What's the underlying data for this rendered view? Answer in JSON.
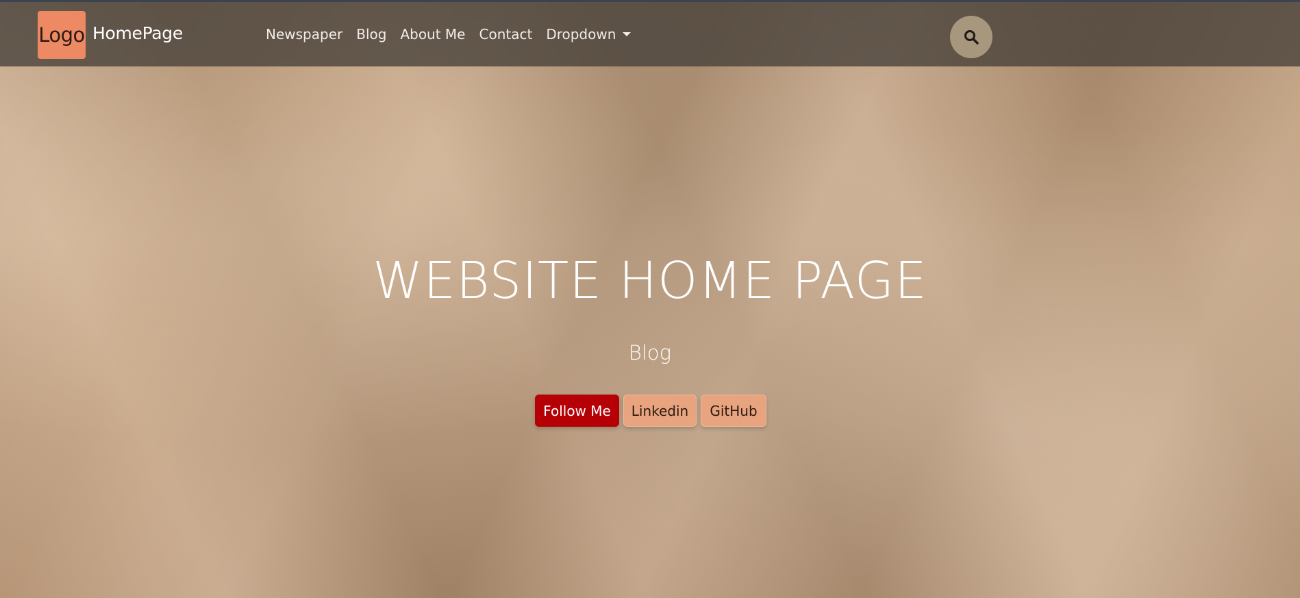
{
  "navbar": {
    "logo_text": "Logo",
    "brand": "HomePage",
    "links": [
      {
        "label": "Newspaper"
      },
      {
        "label": "Blog"
      },
      {
        "label": "About Me"
      },
      {
        "label": "Contact"
      },
      {
        "label": "Dropdown"
      }
    ],
    "search_icon": "search-icon"
  },
  "hero": {
    "title": "WEBSITE HOME PAGE",
    "subtitle": "Blog",
    "buttons": {
      "follow": "Follow Me",
      "linkedin": "Linkedin",
      "github": "GitHub"
    }
  },
  "colors": {
    "logo_bg": "#ee8a63",
    "navbar_bg": "#46403a",
    "search_bg": "#a7977d",
    "primary_button": "#b50006",
    "secondary_button": "#e8a47f",
    "paper_background": "#c49f7c"
  }
}
